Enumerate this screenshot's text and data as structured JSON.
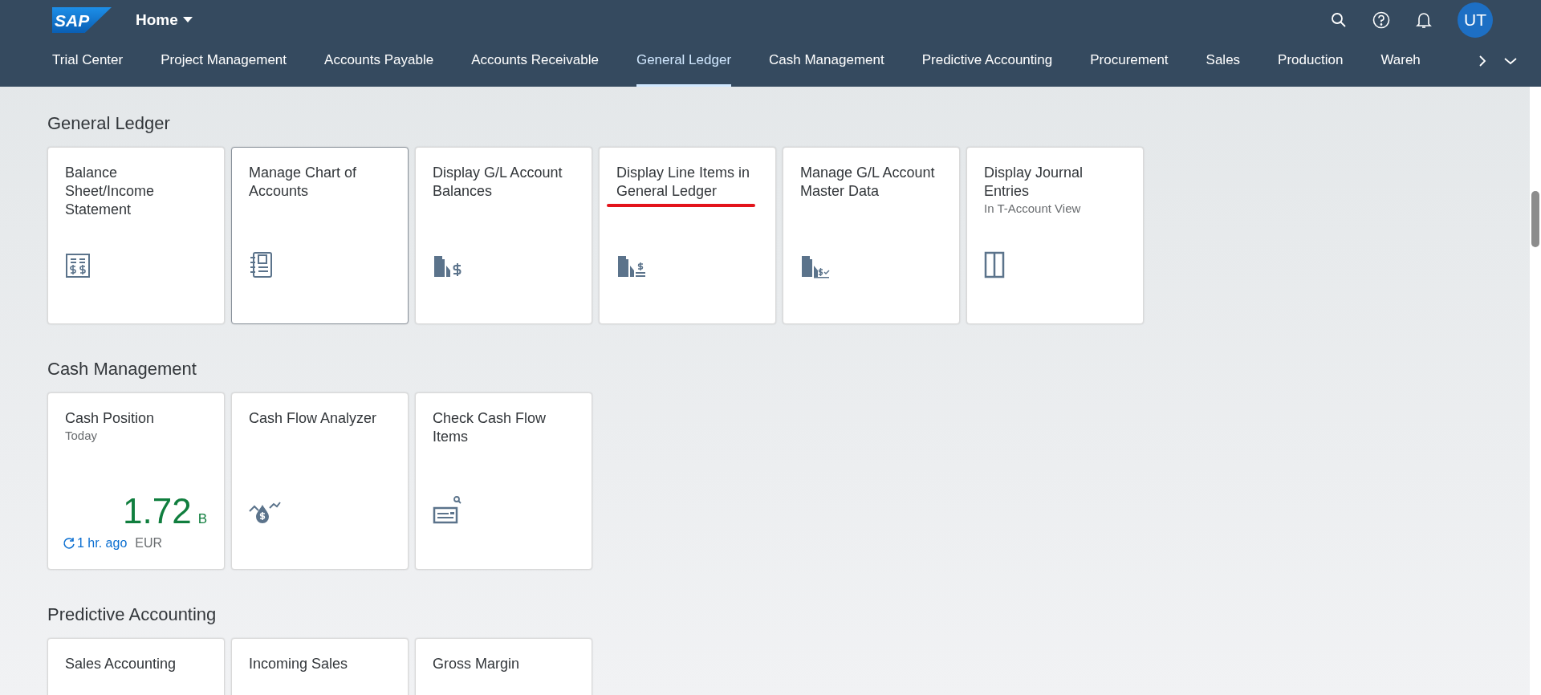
{
  "shell": {
    "logo": "SAP",
    "home": "Home",
    "avatar": "UT"
  },
  "tabs": [
    {
      "label": "Trial Center",
      "selected": false
    },
    {
      "label": "Project Management",
      "selected": false
    },
    {
      "label": "Accounts Payable",
      "selected": false
    },
    {
      "label": "Accounts Receivable",
      "selected": false
    },
    {
      "label": "General Ledger",
      "selected": true
    },
    {
      "label": "Cash Management",
      "selected": false
    },
    {
      "label": "Predictive Accounting",
      "selected": false
    },
    {
      "label": "Procurement",
      "selected": false
    },
    {
      "label": "Sales",
      "selected": false
    },
    {
      "label": "Production",
      "selected": false
    },
    {
      "label": "Wareh",
      "selected": false
    }
  ],
  "sections": [
    {
      "title": "General Ledger",
      "tiles": [
        {
          "kind": "launch",
          "title": "Balance Sheet/Income Statement",
          "focused": false,
          "underlined": false
        },
        {
          "kind": "launch",
          "title": "Manage Chart of Accounts",
          "focused": true,
          "underlined": false
        },
        {
          "kind": "launch",
          "title": "Display G/L Account Balances",
          "focused": false,
          "underlined": false
        },
        {
          "kind": "launch",
          "title": "Display Line Items in General Ledger",
          "focused": false,
          "underlined": true
        },
        {
          "kind": "launch",
          "title": "Manage G/L Account Master Data",
          "focused": false,
          "underlined": false
        },
        {
          "kind": "launch",
          "title": "Display Journal Entries",
          "subtitle": "In T-Account View",
          "focused": false,
          "underlined": false
        }
      ]
    },
    {
      "title": "Cash Management",
      "tiles": [
        {
          "kind": "kpi",
          "title": "Cash Position",
          "subtitle": "Today",
          "value": "1.72",
          "scale": "B",
          "refresh": "1 hr. ago",
          "unit": "EUR",
          "focused": false,
          "underlined": false
        },
        {
          "kind": "launch",
          "title": "Cash Flow Analyzer",
          "focused": false,
          "underlined": false
        },
        {
          "kind": "launch",
          "title": "Check Cash Flow Items",
          "focused": false,
          "underlined": false
        }
      ]
    },
    {
      "title": "Predictive Accounting",
      "tiles": [
        {
          "kind": "cut",
          "title": "Sales Accounting",
          "focused": false,
          "underlined": false
        },
        {
          "kind": "cut",
          "title": "Incoming Sales",
          "focused": false,
          "underlined": false
        },
        {
          "kind": "cut",
          "title": "Gross Margin",
          "focused": false,
          "underlined": false
        }
      ]
    }
  ]
}
